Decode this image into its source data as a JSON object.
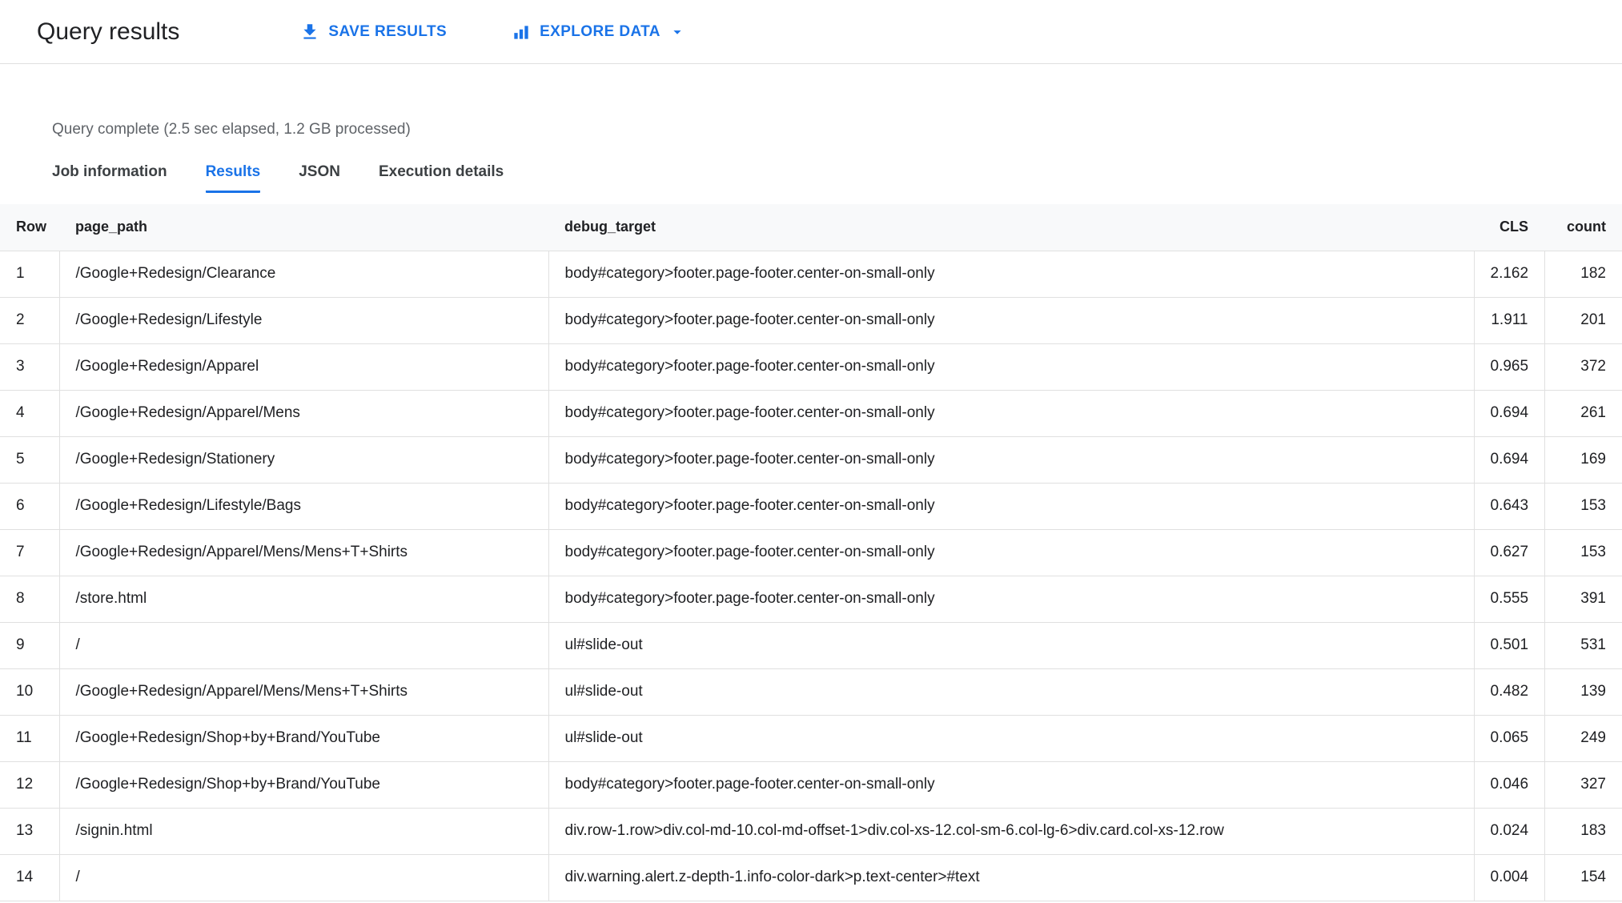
{
  "colors": {
    "accent": "#1a73e8"
  },
  "header": {
    "title": "Query results",
    "save_results_label": "SAVE RESULTS",
    "explore_data_label": "EXPLORE DATA"
  },
  "status_text": "Query complete (2.5 sec elapsed, 1.2 GB processed)",
  "tabs": [
    {
      "label": "Job information",
      "active": false
    },
    {
      "label": "Results",
      "active": true
    },
    {
      "label": "JSON",
      "active": false
    },
    {
      "label": "Execution details",
      "active": false
    }
  ],
  "table": {
    "columns": [
      "Row",
      "page_path",
      "debug_target",
      "CLS",
      "count"
    ],
    "rows": [
      {
        "row": "1",
        "page_path": "/Google+Redesign/Clearance",
        "debug_target": "body#category>footer.page-footer.center-on-small-only",
        "cls": "2.162",
        "count": "182"
      },
      {
        "row": "2",
        "page_path": "/Google+Redesign/Lifestyle",
        "debug_target": "body#category>footer.page-footer.center-on-small-only",
        "cls": "1.911",
        "count": "201"
      },
      {
        "row": "3",
        "page_path": "/Google+Redesign/Apparel",
        "debug_target": "body#category>footer.page-footer.center-on-small-only",
        "cls": "0.965",
        "count": "372"
      },
      {
        "row": "4",
        "page_path": "/Google+Redesign/Apparel/Mens",
        "debug_target": "body#category>footer.page-footer.center-on-small-only",
        "cls": "0.694",
        "count": "261"
      },
      {
        "row": "5",
        "page_path": "/Google+Redesign/Stationery",
        "debug_target": "body#category>footer.page-footer.center-on-small-only",
        "cls": "0.694",
        "count": "169"
      },
      {
        "row": "6",
        "page_path": "/Google+Redesign/Lifestyle/Bags",
        "debug_target": "body#category>footer.page-footer.center-on-small-only",
        "cls": "0.643",
        "count": "153"
      },
      {
        "row": "7",
        "page_path": "/Google+Redesign/Apparel/Mens/Mens+T+Shirts",
        "debug_target": "body#category>footer.page-footer.center-on-small-only",
        "cls": "0.627",
        "count": "153"
      },
      {
        "row": "8",
        "page_path": "/store.html",
        "debug_target": "body#category>footer.page-footer.center-on-small-only",
        "cls": "0.555",
        "count": "391"
      },
      {
        "row": "9",
        "page_path": "/",
        "debug_target": "ul#slide-out",
        "cls": "0.501",
        "count": "531"
      },
      {
        "row": "10",
        "page_path": "/Google+Redesign/Apparel/Mens/Mens+T+Shirts",
        "debug_target": "ul#slide-out",
        "cls": "0.482",
        "count": "139"
      },
      {
        "row": "11",
        "page_path": "/Google+Redesign/Shop+by+Brand/YouTube",
        "debug_target": "ul#slide-out",
        "cls": "0.065",
        "count": "249"
      },
      {
        "row": "12",
        "page_path": "/Google+Redesign/Shop+by+Brand/YouTube",
        "debug_target": "body#category>footer.page-footer.center-on-small-only",
        "cls": "0.046",
        "count": "327"
      },
      {
        "row": "13",
        "page_path": "/signin.html",
        "debug_target": "div.row-1.row>div.col-md-10.col-md-offset-1>div.col-xs-12.col-sm-6.col-lg-6>div.card.col-xs-12.row",
        "cls": "0.024",
        "count": "183"
      },
      {
        "row": "14",
        "page_path": "/",
        "debug_target": "div.warning.alert.z-depth-1.info-color-dark>p.text-center>#text",
        "cls": "0.004",
        "count": "154"
      }
    ]
  }
}
